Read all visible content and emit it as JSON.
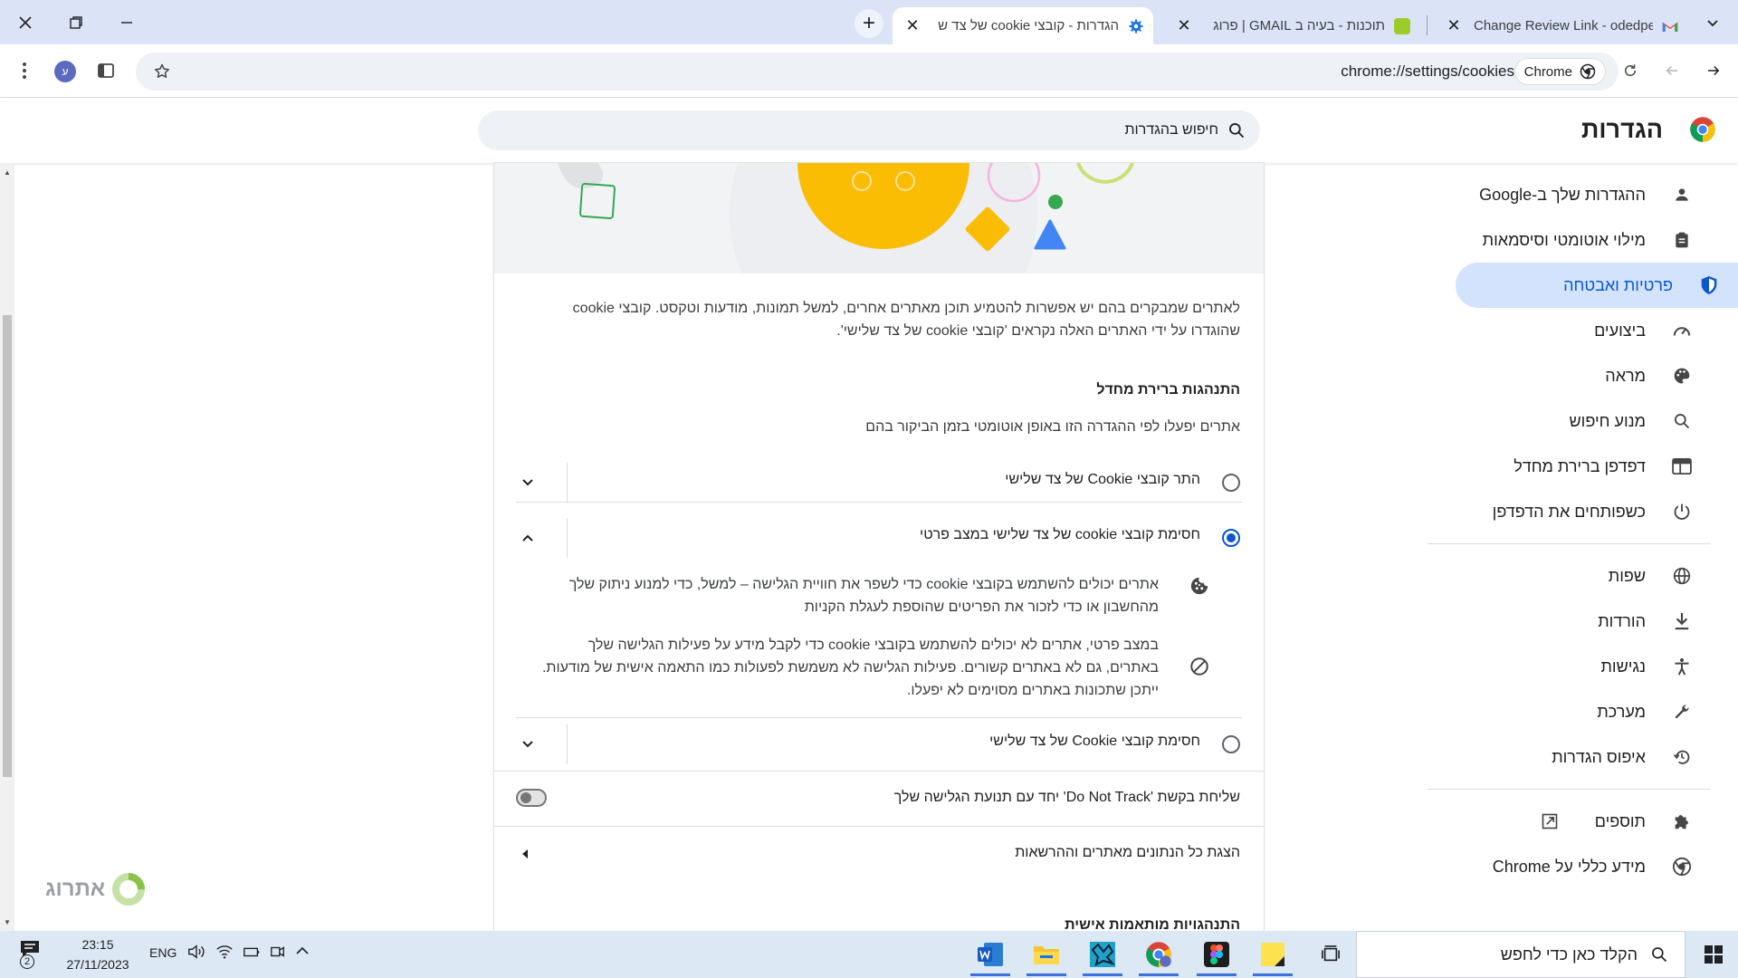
{
  "browser": {
    "tabs": [
      {
        "title": "Change Review Link - odedperi",
        "favicon": "gmail-icon"
      },
      {
        "title": "תוכנות - בעיה ב GMAIL | פרוג",
        "favicon": "forum-icon"
      },
      {
        "title": "הגדרות - קובצי cookie של צד ש",
        "favicon": "settings-gear-icon"
      }
    ],
    "new_tab": "+",
    "url": "chrome://settings/cookies",
    "chip_label": "Chrome",
    "profile_initial": "ע"
  },
  "settings": {
    "title": "הגדרות",
    "search_placeholder": "חיפוש בהגדרות",
    "nav": [
      {
        "label": "ההגדרות שלך ב-Google",
        "icon": "person-icon"
      },
      {
        "label": "מילוי אוטומטי וסיסמאות",
        "icon": "clipboard-icon"
      },
      {
        "label": "פרטיות ואבטחה",
        "icon": "shield-icon",
        "selected": true
      },
      {
        "label": "ביצועים",
        "icon": "speedometer-icon"
      },
      {
        "label": "מראה",
        "icon": "palette-icon"
      },
      {
        "label": "מנוע חיפוש",
        "icon": "search-icon"
      },
      {
        "label": "דפדפן ברירת מחדל",
        "icon": "browser-icon"
      },
      {
        "label": "כשפותחים את הדפדפן",
        "icon": "power-icon"
      },
      {
        "label": "שפות",
        "icon": "globe-icon"
      },
      {
        "label": "הורדות",
        "icon": "download-icon"
      },
      {
        "label": "נגישות",
        "icon": "accessibility-icon"
      },
      {
        "label": "מערכת",
        "icon": "wrench-icon"
      },
      {
        "label": "איפוס הגדרות",
        "icon": "history-icon"
      },
      {
        "label": "תוספים",
        "icon": "puzzle-icon"
      },
      {
        "label": "מידע כללי על Chrome",
        "icon": "chrome-icon"
      }
    ]
  },
  "content": {
    "intro_line1": "לאתרים שמבקרים בהם יש אפשרות להטמיע תוכן מאתרים אחרים, למשל תמונות, מודעות וטקסט. קובצי cookie",
    "intro_line2": "שהוגדרו על ידי האתרים האלה נקראים 'קובצי cookie של צד שלישי'.",
    "default_heading": "התנהגות ברירת מחדל",
    "default_sub": "אתרים יפעלו לפי ההגדרה הזו באופן אוטומטי בזמן הביקור בהם",
    "options": [
      {
        "label": "התר קובצי Cookie של צד שלישי",
        "selected": false,
        "expanded": false
      },
      {
        "label": "חסימת קובצי cookie של צד שלישי במצב פרטי",
        "selected": true,
        "expanded": true
      },
      {
        "label": "חסימת קובצי Cookie של צד שלישי",
        "selected": false,
        "expanded": false
      }
    ],
    "detail1_line1": "אתרים יכולים להשתמש בקובצי cookie כדי לשפר את חוויית הגלישה – למשל, כדי למנוע ניתוק שלך",
    "detail1_line2": "מהחשבון או כדי לזכור את הפריטים שהוספת לעגלת הקניות",
    "detail2_line1": "במצב פרטי, אתרים לא יכולים להשתמש בקובצי cookie כדי לקבל מידע על פעילות הגלישה שלך",
    "detail2_line2": "באתרים, גם לא באתרים קשורים. פעילות הגלישה לא משמשת לפעולות כמו התאמה אישית של מודעות.",
    "detail2_line3": "ייתכן שתכונות באתרים מסוימים לא יפעלו.",
    "dnt_label": "שליחת בקשת 'Do Not Track' יחד עם תנועת הגלישה שלך",
    "dnt_enabled": false,
    "all_data_label": "הצגת כל הנתונים מאתרים וההרשאות",
    "next_heading": "התנהגויות מותאמות אישית"
  },
  "watermark": "אתרוג",
  "taskbar": {
    "search_placeholder": "הקלד כאן כדי לחפש",
    "time": "23:15",
    "date": "27/11/2023",
    "lang": "ENG",
    "notification_count": "2",
    "apps": [
      "word-icon",
      "file-explorer-icon",
      "sketch-app-icon",
      "chrome-profile-icon",
      "figma-icon",
      "sticky-notes-icon"
    ]
  }
}
